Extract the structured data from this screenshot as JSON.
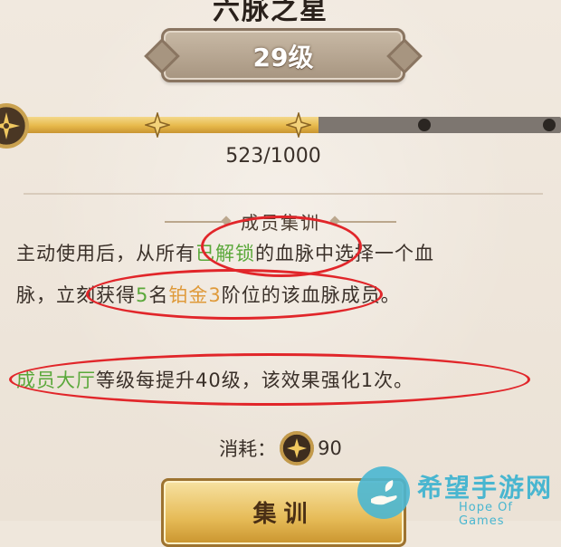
{
  "header": {
    "title": "六脉之星",
    "level_label": "29级"
  },
  "progress": {
    "current": 523,
    "max": 1000,
    "text": "523/1000",
    "fill_fraction": 0.56
  },
  "skill": {
    "title": "成员集训",
    "line1": {
      "prefix": "主动使用后，从所有",
      "highlight": "已解锁",
      "suffix": "的血脉中选择一个血"
    },
    "line2": {
      "prefix": "脉，立刻获得",
      "count": "5",
      "mid": "名",
      "grade": "铂金3",
      "suffix": "阶位的该血脉成员。"
    },
    "line3": {
      "highlight": "成员大厅",
      "suffix": "等级每提升40级，该效果强化1次。"
    }
  },
  "cost": {
    "label": "消耗：",
    "value": "90"
  },
  "action": {
    "button_label": "集训"
  },
  "watermark": {
    "title": "希望手游网",
    "subtitle": "Hope Of Games"
  },
  "colors": {
    "green_text": "#5aa83a",
    "orange_text": "#df9a3a",
    "annotation_red": "#e1262a",
    "bar_gold": "#e7b94b",
    "bar_gray": "#7d7670",
    "watermark_blue": "#49b6d0"
  },
  "icons": {
    "medal": "star-medal-icon",
    "node": "star-node-icon",
    "coin": "training-token-icon",
    "watermark": "hand-leaf-logo-icon"
  }
}
